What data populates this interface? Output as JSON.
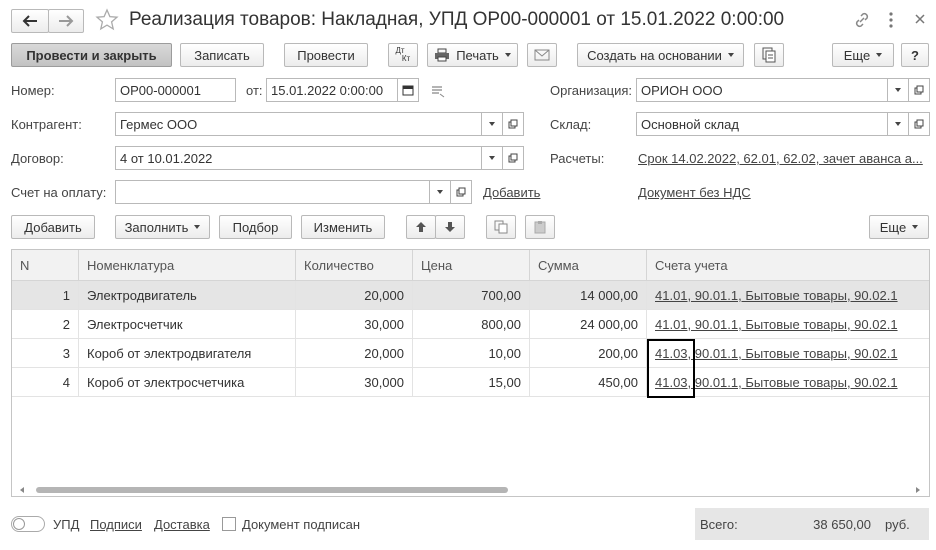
{
  "window": {
    "title": "Реализация товаров: Накладная, УПД ОР00-000001 от 15.01.2022 0:00:00"
  },
  "toolbar": {
    "post_close": "Провести и закрыть",
    "write": "Записать",
    "post": "Провести",
    "dt_kt_top": "Дт",
    "dt_kt_bottom": "Кт",
    "print": "Печать",
    "create_based": "Создать на основании",
    "more": "Еще",
    "help": "?"
  },
  "form": {
    "number_label": "Номер:",
    "number_value": "ОР00-000001",
    "from_label": "от:",
    "date_value": "15.01.2022  0:00:00",
    "org_label": "Организация:",
    "org_value": "ОРИОН ООО",
    "counterparty_label": "Контрагент:",
    "counterparty_value": "Гермес ООО",
    "warehouse_label": "Склад:",
    "warehouse_value": "Основной склад",
    "contract_label": "Договор:",
    "contract_value": "4 от 10.01.2022",
    "settlements_label": "Расчеты:",
    "settlements_link": "Срок 14.02.2022, 62.01, 62.02, зачет аванса а...",
    "invoice_label": "Счет на оплату:",
    "invoice_value": "",
    "invoice_add": "Добавить",
    "vat_link": "Документ без НДС"
  },
  "table_toolbar": {
    "add": "Добавить",
    "fill": "Заполнить",
    "pick": "Подбор",
    "change": "Изменить",
    "more": "Еще"
  },
  "table": {
    "headers": [
      "N",
      "Номенклатура",
      "Количество",
      "Цена",
      "Сумма",
      "Счета учета"
    ],
    "rows": [
      {
        "n": "1",
        "name": "Электродвигатель",
        "qty": "20,000",
        "price": "700,00",
        "sum": "14 000,00",
        "accounts": "41.01, 90.01.1, Бытовые товары, 90.02.1"
      },
      {
        "n": "2",
        "name": "Электросчетчик",
        "qty": "30,000",
        "price": "800,00",
        "sum": "24 000,00",
        "accounts": "41.01, 90.01.1, Бытовые товары, 90.02.1"
      },
      {
        "n": "3",
        "name": "Короб от электродвигателя",
        "qty": "20,000",
        "price": "10,00",
        "sum": "200,00",
        "accounts": "41.03, 90.01.1, Бытовые товары, 90.02.1"
      },
      {
        "n": "4",
        "name": "Короб от электросчетчика",
        "qty": "30,000",
        "price": "15,00",
        "sum": "450,00",
        "accounts": "41.03, 90.01.1, Бытовые товары, 90.02.1"
      }
    ]
  },
  "footer": {
    "upd_label": "УПД",
    "signatures": "Подписи",
    "delivery": "Доставка",
    "signed_label": "Документ подписан",
    "total_label": "Всего:",
    "total_value": "38 650,00",
    "currency": "руб."
  },
  "colors": {
    "highlight_border": "#000000",
    "selected_row": "#e5e5e5"
  }
}
